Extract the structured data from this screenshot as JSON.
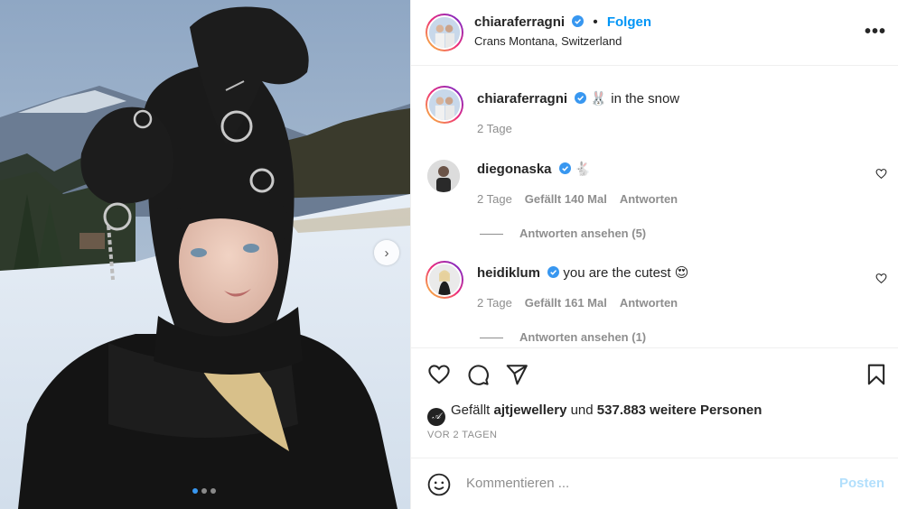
{
  "post": {
    "photo_alt": "Person in black fluffy bunny-ear hood with silver rings in snowy mountain landscape",
    "carousel_dots": 3,
    "active_dot": 0
  },
  "header": {
    "username": "chiaraferragni",
    "separator": "•",
    "follow_label": "Folgen",
    "location": "Crans Montana, Switzerland",
    "more_label": "•••"
  },
  "caption": {
    "username": "chiaraferragni",
    "text": "🐰 in the snow",
    "time": "2 Tage"
  },
  "comments": [
    {
      "username": "diegonaska",
      "text": "🐇",
      "time": "2 Tage",
      "likes": "Gefällt 140 Mal",
      "reply_label": "Antworten",
      "view_replies": "Antworten ansehen (5)"
    },
    {
      "username": "heidiklum",
      "text": "you are the cutest 😍",
      "time": "2 Tage",
      "likes": "Gefällt 161 Mal",
      "reply_label": "Antworten",
      "view_replies": "Antworten ansehen (1)"
    }
  ],
  "actions": {
    "likes_prefix": "Gefällt",
    "liker": "ajtjewellery",
    "likes_middle": "und",
    "likes_count": "537.883 weitere Personen",
    "date": "VOR 2 TAGEN"
  },
  "composer": {
    "placeholder": "Kommentieren ...",
    "post_label": "Posten"
  },
  "colors": {
    "link_blue": "#0095f6",
    "verified_blue": "#3897f0",
    "post_disabled": "#b2dffc",
    "muted_text": "#8e8e8e"
  }
}
